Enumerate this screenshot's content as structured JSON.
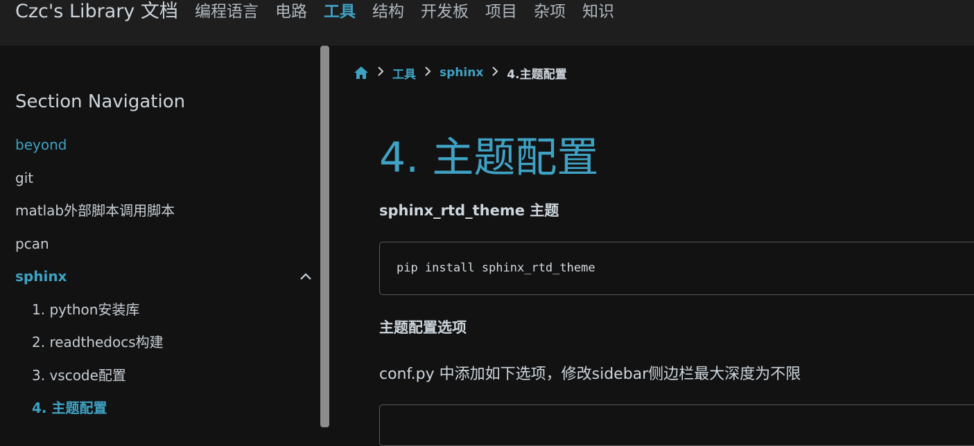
{
  "header": {
    "brand": "Czc's Library 文档",
    "nav": [
      {
        "label": "编程语言"
      },
      {
        "label": "电路"
      },
      {
        "label": "工具"
      },
      {
        "label": "结构"
      },
      {
        "label": "开发板"
      },
      {
        "label": "项目"
      },
      {
        "label": "杂项"
      },
      {
        "label": "知识"
      }
    ],
    "active_index": 2
  },
  "sidebar": {
    "title": "Section Navigation",
    "items": [
      {
        "label": "beyond"
      },
      {
        "label": "git"
      },
      {
        "label": "matlab外部脚本调用脚本"
      },
      {
        "label": "pcan"
      },
      {
        "label": "sphinx"
      },
      {
        "label": "1. python安装库"
      },
      {
        "label": "2. readthedocs构建"
      },
      {
        "label": "3. vscode配置"
      },
      {
        "label": "4. 主题配置"
      }
    ]
  },
  "breadcrumb": {
    "items": [
      {
        "label": "工具"
      },
      {
        "label": "sphinx"
      },
      {
        "label": "4.主题配置"
      }
    ]
  },
  "content": {
    "title": "4. 主题配置",
    "heading1": "sphinx_rtd_theme 主题",
    "code1": "pip install sphinx_rtd_theme",
    "heading2": "主题配置选项",
    "paragraph": "conf.py 中添加如下选项，修改sidebar侧边栏最大深度为不限"
  },
  "colors": {
    "accent": "#3fa2c4",
    "background": "#121212",
    "header_bg": "#1e1e1e",
    "text": "#ced6dd"
  }
}
